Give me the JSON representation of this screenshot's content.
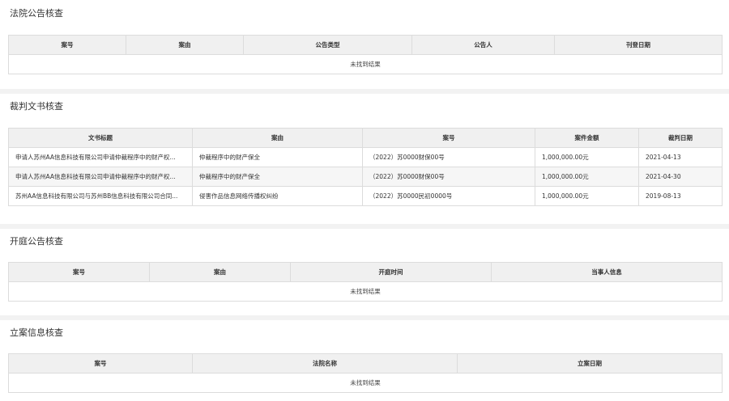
{
  "court_notice": {
    "title": "法院公告核查",
    "headers": [
      "案号",
      "案由",
      "公告类型",
      "公告人",
      "刊登日期"
    ],
    "empty_text": "未找到结果"
  },
  "judgment": {
    "title": "裁判文书核查",
    "headers": [
      "文书标题",
      "案由",
      "案号",
      "案件金额",
      "裁判日期"
    ],
    "rows": [
      [
        "申请人苏州AA信息科技有限公司申请仲裁程序中的财产权...",
        "仲裁程序中的财产保全",
        "（2022）苏0000财保00号",
        "1,000,000.00元",
        "2021-04-13"
      ],
      [
        "申请人苏州AA信息科技有限公司申请仲裁程序中的财产权...",
        "仲裁程序中的财产保全",
        "（2022）苏0000财保00号",
        "1,000,000.00元",
        "2021-04-30"
      ],
      [
        "苏州AA信息科技有限公司与苏州BB信息科技有限公司合同...",
        "侵害作品信息网络传播权纠纷",
        "（2022）苏0000民初0000号",
        "1,000,000.00元",
        "2019-08-13"
      ]
    ]
  },
  "hearing": {
    "title": "开庭公告核查",
    "headers": [
      "案号",
      "案由",
      "开庭时间",
      "当事人信息"
    ],
    "empty_text": "未找到结果"
  },
  "filing": {
    "title": "立案信息核查",
    "headers": [
      "案号",
      "法院名称",
      "立案日期"
    ],
    "empty_text": "未找到结果"
  }
}
